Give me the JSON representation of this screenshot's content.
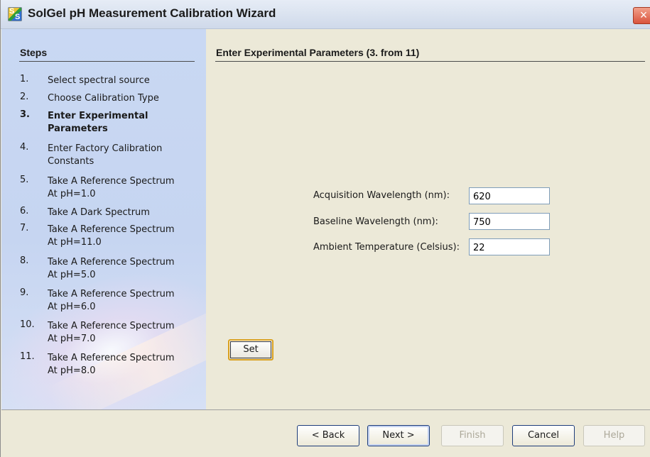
{
  "window": {
    "title": "SolGel pH Measurement Calibration Wizard",
    "app_icon_letters": [
      "S",
      "S"
    ],
    "close_label": "×"
  },
  "steps_panel": {
    "header": "Steps",
    "current_step": 3,
    "items": [
      {
        "num": "1.",
        "lines": [
          "Select spectral source"
        ]
      },
      {
        "num": "2.",
        "lines": [
          "Choose Calibration Type"
        ]
      },
      {
        "num": "3.",
        "lines": [
          "Enter Experimental",
          "Parameters"
        ]
      },
      {
        "num": "4.",
        "lines": [
          "Enter Factory Calibration",
          "Constants"
        ]
      },
      {
        "num": "5.",
        "lines": [
          "Take A Reference Spectrum",
          "At pH=1.0"
        ]
      },
      {
        "num": "6.",
        "lines": [
          "Take A Dark Spectrum"
        ]
      },
      {
        "num": "7.",
        "lines": [
          "Take A Reference Spectrum",
          "At pH=11.0"
        ]
      },
      {
        "num": "8.",
        "lines": [
          "Take A Reference Spectrum",
          "At pH=5.0"
        ]
      },
      {
        "num": "9.",
        "lines": [
          "Take A Reference Spectrum",
          "At pH=6.0"
        ]
      },
      {
        "num": "10.",
        "lines": [
          "Take A Reference Spectrum",
          "At pH=7.0"
        ]
      },
      {
        "num": "11.",
        "lines": [
          "Take A Reference Spectrum",
          "At pH=8.0"
        ]
      }
    ]
  },
  "content": {
    "header": "Enter Experimental Parameters (3. from 11)",
    "params": [
      {
        "label": "Acquisition Wavelength (nm):",
        "value": "620"
      },
      {
        "label": "Baseline Wavelength (nm):",
        "value": "750"
      },
      {
        "label": "Ambient Temperature (Celsius):",
        "value": "22"
      }
    ],
    "set_label": "Set"
  },
  "buttons": {
    "back": "< Back",
    "next": "Next >",
    "finish": "Finish",
    "cancel": "Cancel",
    "help": "Help"
  }
}
